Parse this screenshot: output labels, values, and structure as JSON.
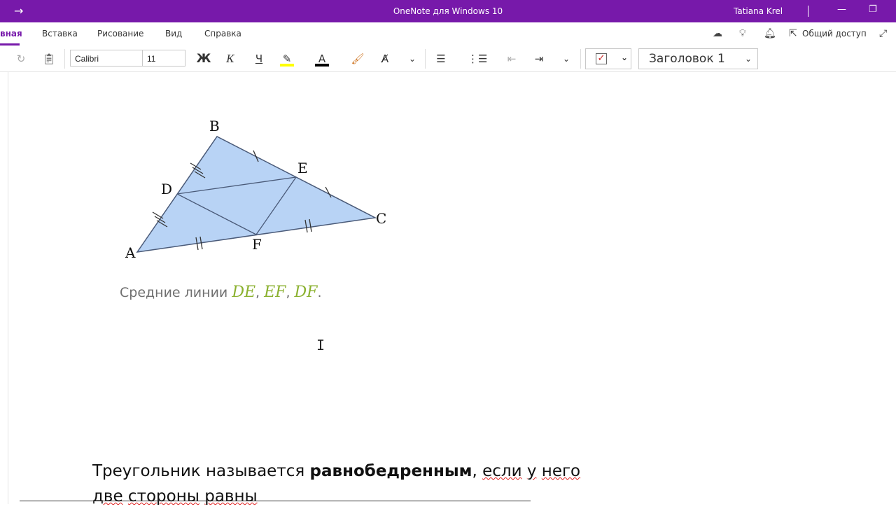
{
  "titlebar": {
    "app_title": "OneNote для Windows 10",
    "user": "Tatiana Krel",
    "back_icon": "arrow-right-icon"
  },
  "ribbon": {
    "tabs": [
      {
        "label": "вная",
        "active": true
      },
      {
        "label": "Вставка"
      },
      {
        "label": "Рисование"
      },
      {
        "label": "Вид"
      },
      {
        "label": "Справка"
      }
    ],
    "share_label": "Общий доступ"
  },
  "toolbar": {
    "font_name": "Calibri",
    "font_size": "11",
    "bold": "Ж",
    "italic": "К",
    "underline": "Ч",
    "style": "Заголовок 1",
    "highlight_color": "#ffff00",
    "font_color": "#000000"
  },
  "figure": {
    "labels": {
      "A": "A",
      "B": "B",
      "C": "C",
      "D": "D",
      "E": "E",
      "F": "F"
    },
    "fill_color": "#b8d3f5"
  },
  "caption": {
    "text": "Средние линии ",
    "m1": "DE",
    "sep1": ", ",
    "m2": "EF",
    "sep2": ", ",
    "m3": "DF",
    "end": "."
  },
  "body": {
    "part1": "Треугольник называется ",
    "bold_word": "равнобедренным",
    "part2": ", ",
    "w_esli": "если",
    "space1": " ",
    "w_u": "у",
    "space2": " ",
    "w_nego": "него",
    "line2_w1": "две",
    "line2_space1": " ",
    "line2_w2": "стороны",
    "line2_space2": " ",
    "line2_w3": "равны"
  },
  "accent_color": "#7719aa"
}
